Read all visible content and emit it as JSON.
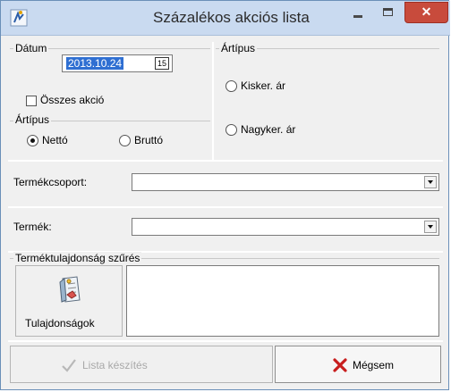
{
  "window": {
    "title": "Százalékos akciós lista",
    "close_glyph": "✕"
  },
  "date_group": {
    "label": "Dátum",
    "date_value": "2013.10.24",
    "calendar_icon_text": "15",
    "all_actions_label": "Összes akció",
    "all_actions_checked": false
  },
  "price_type_left": {
    "label": "Ártípus",
    "options": [
      "Nettó",
      "Bruttó"
    ],
    "selected": "Nettó"
  },
  "price_type_right": {
    "label": "Ártípus",
    "options": [
      "Kisker. ár",
      "Nagyker. ár"
    ],
    "selected": null
  },
  "product_group": {
    "label": "Termékcsoport:",
    "value": ""
  },
  "product": {
    "label": "Termék:",
    "value": ""
  },
  "property_filter": {
    "label": "Terméktulajdonság szűrés",
    "button_label": "Tulajdonságok",
    "value": ""
  },
  "footer": {
    "create_list_label": "Lista készítés",
    "create_list_enabled": false,
    "cancel_label": "Mégsem"
  },
  "colors": {
    "titlebar": "#c9daf0",
    "close": "#c84b3c",
    "selection": "#2f6fd2",
    "cancel_icon": "#c81e1e"
  }
}
